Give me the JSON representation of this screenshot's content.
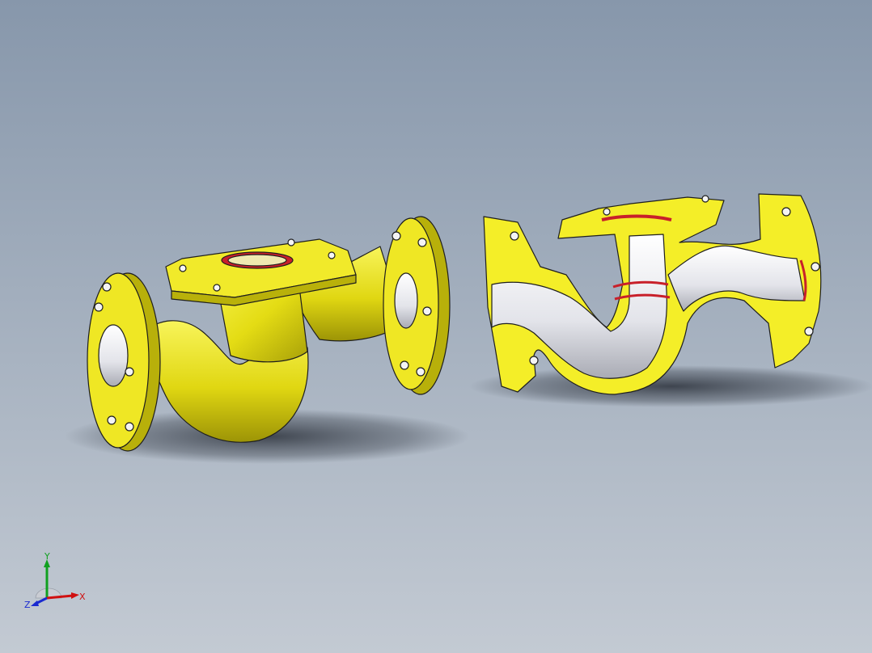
{
  "viewport": {
    "background_top": "#8797ab",
    "background_bottom": "#c3cad3"
  },
  "model": {
    "body_color": "#e9e31a",
    "section_face_color": "#f6f02c",
    "bore_color": "#e8e8ec",
    "gasket_color": "#c8202a",
    "edge_color": "#1e1e1e"
  },
  "triad": {
    "x_label": "X",
    "y_label": "Y",
    "z_label": "Z",
    "x_color": "#d01010",
    "y_color": "#10a020",
    "z_color": "#1a2ad0"
  }
}
